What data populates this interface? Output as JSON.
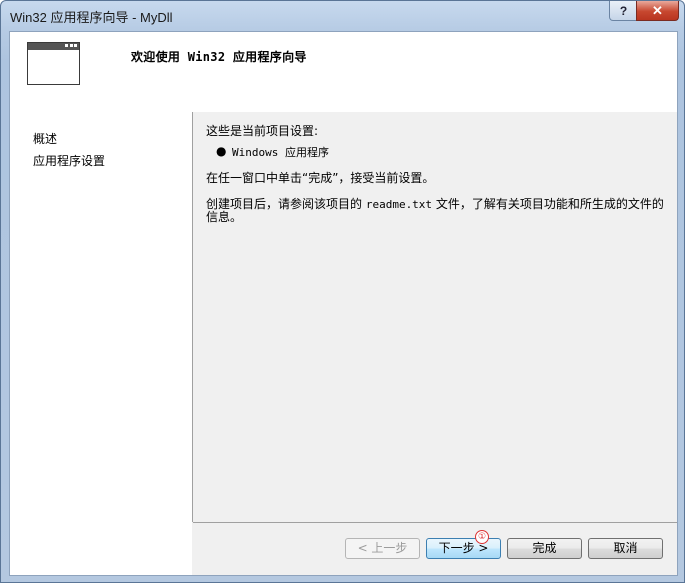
{
  "window": {
    "title": "Win32 应用程序向导 - MyDll",
    "help_label": "?",
    "close_label": "✕"
  },
  "header": {
    "title": "欢迎使用 Win32 应用程序向导",
    "icon": "window-icon"
  },
  "nav": {
    "items": [
      {
        "label": "概述"
      },
      {
        "label": "应用程序设置"
      }
    ]
  },
  "content": {
    "intro": "这些是当前项目设置:",
    "bullets": [
      "Windows 应用程序"
    ],
    "finish_hint": "在任一窗口中单击“完成”，接受当前设置。",
    "after_create_prefix": "创建项目后，请参阅该项目的 ",
    "readme": "readme.txt",
    "after_create_suffix": " 文件，了解有关项目功能和所生成的文件的信息。"
  },
  "buttons": {
    "prev": "< 上一步",
    "next": "下一步 >",
    "finish": "完成",
    "cancel": "取消"
  },
  "annotation": {
    "marker": "①",
    "color": "#dd3333"
  }
}
